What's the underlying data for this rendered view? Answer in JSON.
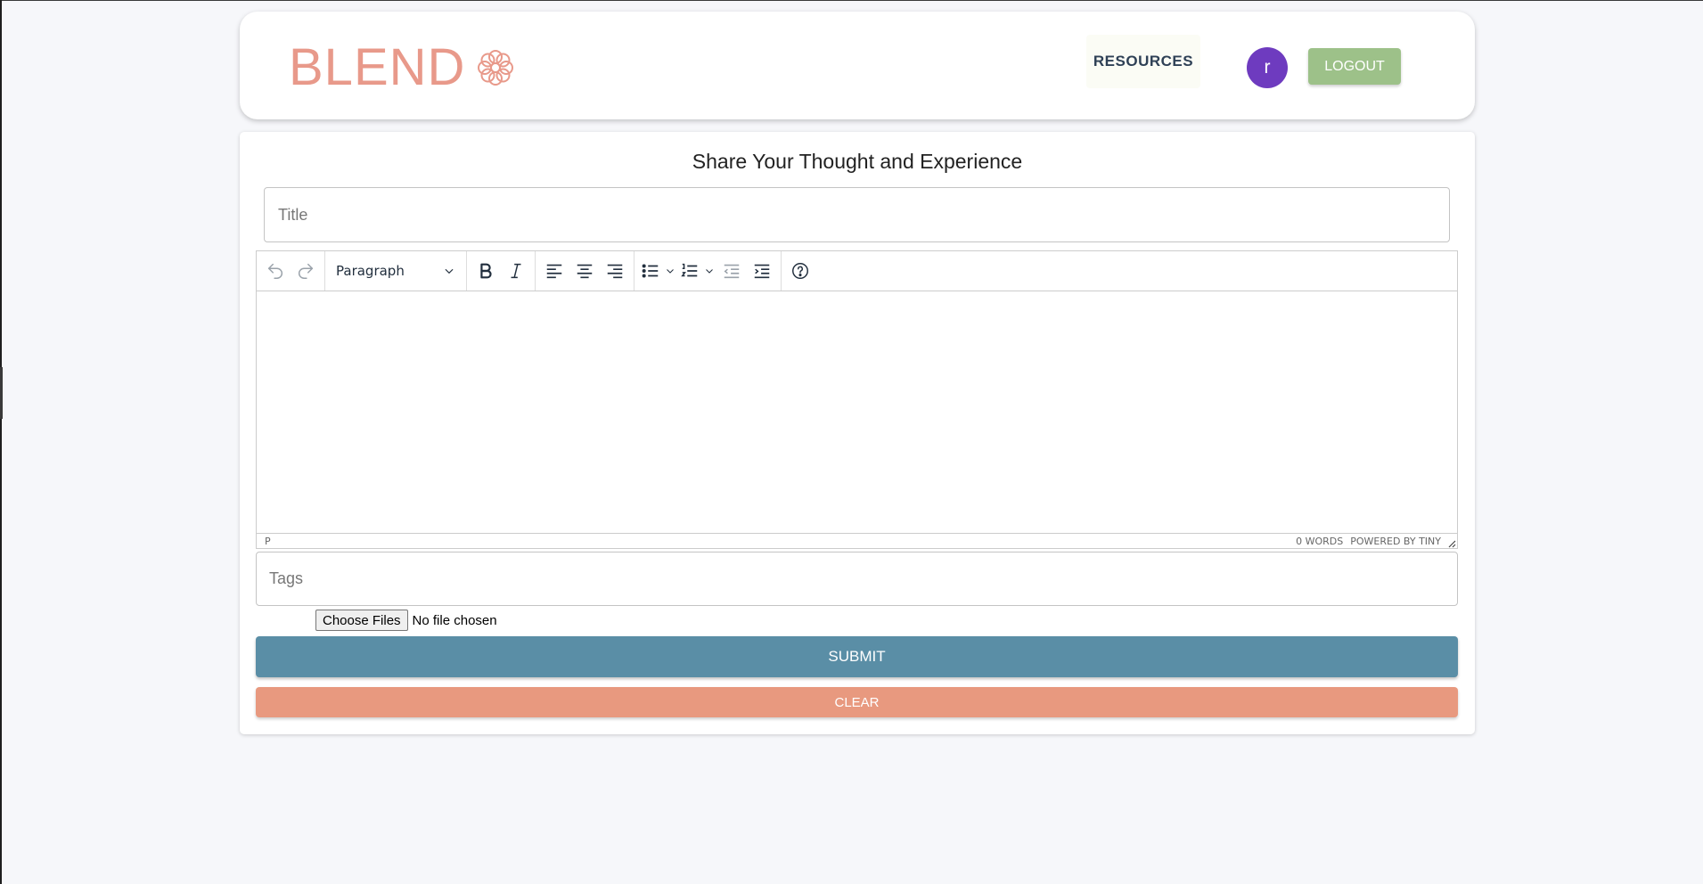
{
  "header": {
    "logo_text": "BLEND",
    "logo_icon": "flower-knot-icon",
    "resources_label": "RESOURCES",
    "avatar_initial": "r",
    "logout_label": "LOGOUT"
  },
  "form": {
    "heading": "Share Your Thought and Experience",
    "title_placeholder": "Title",
    "title_value": "",
    "tags_placeholder": "Tags",
    "tags_value": "",
    "file_button_label": "Choose Files",
    "file_status": "No file chosen",
    "submit_label": "SUBMIT",
    "clear_label": "CLEAR"
  },
  "editor": {
    "block_format": "Paragraph",
    "toolbar_icons": [
      "undo-icon",
      "redo-icon",
      "bold-icon",
      "italic-icon",
      "align-left-icon",
      "align-center-icon",
      "align-right-icon",
      "bullet-list-icon",
      "numbered-list-icon",
      "outdent-icon",
      "indent-icon",
      "help-icon"
    ],
    "status_path": "P",
    "word_count": "0 WORDS",
    "branding": "POWERED BY TINY",
    "content": ""
  },
  "colors": {
    "brand": "#e8998a",
    "avatar": "#6e3bbf",
    "logout": "#9dc189",
    "submit": "#5a8ea6",
    "clear": "#e8997f",
    "background": "#f6f7fa"
  }
}
